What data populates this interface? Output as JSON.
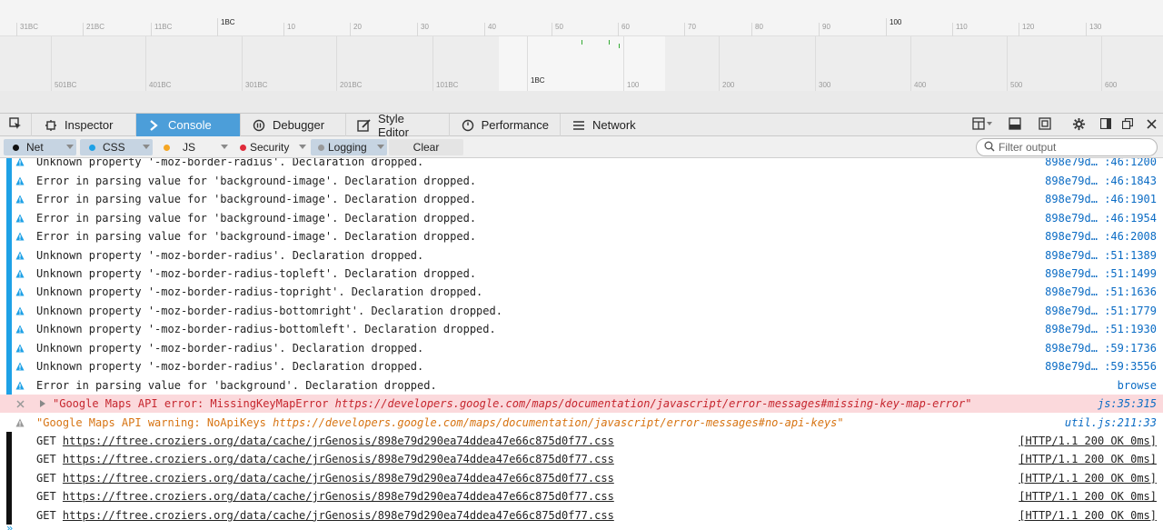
{
  "timeline": {
    "top_ticks": [
      "31BC",
      "21BC",
      "11BC",
      "1BC",
      "10",
      "20",
      "30",
      "40",
      "50",
      "60",
      "70",
      "80",
      "90",
      "100",
      "110",
      "120",
      "130"
    ],
    "bottom_ticks": [
      "501BC",
      "401BC",
      "301BC",
      "201BC",
      "101BC",
      "1BC",
      "100",
      "200",
      "300",
      "400",
      "500",
      "600"
    ]
  },
  "toolbar": {
    "tabs": [
      {
        "label": "Inspector",
        "icon": "inspector-icon"
      },
      {
        "label": "Console",
        "icon": "console-icon"
      },
      {
        "label": "Debugger",
        "icon": "debugger-icon"
      },
      {
        "label": "Style Editor",
        "icon": "style-editor-icon"
      },
      {
        "label": "Performance",
        "icon": "performance-icon"
      },
      {
        "label": "Network",
        "icon": "network-icon"
      }
    ],
    "active_tab": "Console"
  },
  "filters": {
    "net": "Net",
    "css": "CSS",
    "js": "JS",
    "security": "Security",
    "logging": "Logging",
    "clear": "Clear",
    "search_placeholder": "Filter output",
    "colors": {
      "net": "#111111",
      "css": "#1ea1e6",
      "js": "#f5a623",
      "security": "#e02b3a",
      "logging": "#999999"
    }
  },
  "console": {
    "rows": [
      {
        "type": "css",
        "text": "Unknown property '-moz-border-radius'.  Declaration dropped.",
        "source": "898e79d… :46:1200"
      },
      {
        "type": "css",
        "text": "Error in parsing value for 'background-image'.  Declaration dropped.",
        "source": "898e79d… :46:1843"
      },
      {
        "type": "css",
        "text": "Error in parsing value for 'background-image'.  Declaration dropped.",
        "source": "898e79d… :46:1901"
      },
      {
        "type": "css",
        "text": "Error in parsing value for 'background-image'.  Declaration dropped.",
        "source": "898e79d… :46:1954"
      },
      {
        "type": "css",
        "text": "Error in parsing value for 'background-image'.  Declaration dropped.",
        "source": "898e79d… :46:2008"
      },
      {
        "type": "css",
        "text": "Unknown property '-moz-border-radius'.  Declaration dropped.",
        "source": "898e79d… :51:1389"
      },
      {
        "type": "css",
        "text": "Unknown property '-moz-border-radius-topleft'.  Declaration dropped.",
        "source": "898e79d… :51:1499"
      },
      {
        "type": "css",
        "text": "Unknown property '-moz-border-radius-topright'.  Declaration dropped.",
        "source": "898e79d… :51:1636"
      },
      {
        "type": "css",
        "text": "Unknown property '-moz-border-radius-bottomright'.  Declaration dropped.",
        "source": "898e79d… :51:1779"
      },
      {
        "type": "css",
        "text": "Unknown property '-moz-border-radius-bottomleft'.  Declaration dropped.",
        "source": "898e79d… :51:1930"
      },
      {
        "type": "css",
        "text": "Unknown property '-moz-border-radius'.  Declaration dropped.",
        "source": "898e79d… :59:1736"
      },
      {
        "type": "css",
        "text": "Unknown property '-moz-border-radius'.  Declaration dropped.",
        "source": "898e79d… :59:3556"
      },
      {
        "type": "css",
        "text": "Error in parsing value for 'background'.  Declaration dropped.",
        "source": "browse"
      },
      {
        "type": "err",
        "prefix": "\"Google Maps API error: MissingKeyMapError ",
        "url": "https://developers.google.com/maps/documentation/javascript/error-messages#missing-key-map-error",
        "suffix": "\"",
        "source": "js:35:315"
      },
      {
        "type": "warn",
        "prefix": "\"Google Maps API warning: NoApiKeys ",
        "url": "https://developers.google.com/maps/documentation/javascript/error-messages#no-api-keys",
        "suffix": "\"",
        "source": "util.js:211:33"
      },
      {
        "type": "net",
        "method": "GET",
        "url": "https://ftree.croziers.org/data/cache/jrGenosis/898e79d290ea74ddea47e66c875d0f77.css",
        "source": "[HTTP/1.1 200 OK 0ms]"
      },
      {
        "type": "net",
        "method": "GET",
        "url": "https://ftree.croziers.org/data/cache/jrGenosis/898e79d290ea74ddea47e66c875d0f77.css",
        "source": "[HTTP/1.1 200 OK 0ms]"
      },
      {
        "type": "net",
        "method": "GET",
        "url": "https://ftree.croziers.org/data/cache/jrGenosis/898e79d290ea74ddea47e66c875d0f77.css",
        "source": "[HTTP/1.1 200 OK 0ms]"
      },
      {
        "type": "net",
        "method": "GET",
        "url": "https://ftree.croziers.org/data/cache/jrGenosis/898e79d290ea74ddea47e66c875d0f77.css",
        "source": "[HTTP/1.1 200 OK 0ms]"
      },
      {
        "type": "net",
        "method": "GET",
        "url": "https://ftree.croziers.org/data/cache/jrGenosis/898e79d290ea74ddea47e66c875d0f77.css",
        "source": "[HTTP/1.1 200 OK 0ms]"
      }
    ],
    "prompt": "»"
  }
}
